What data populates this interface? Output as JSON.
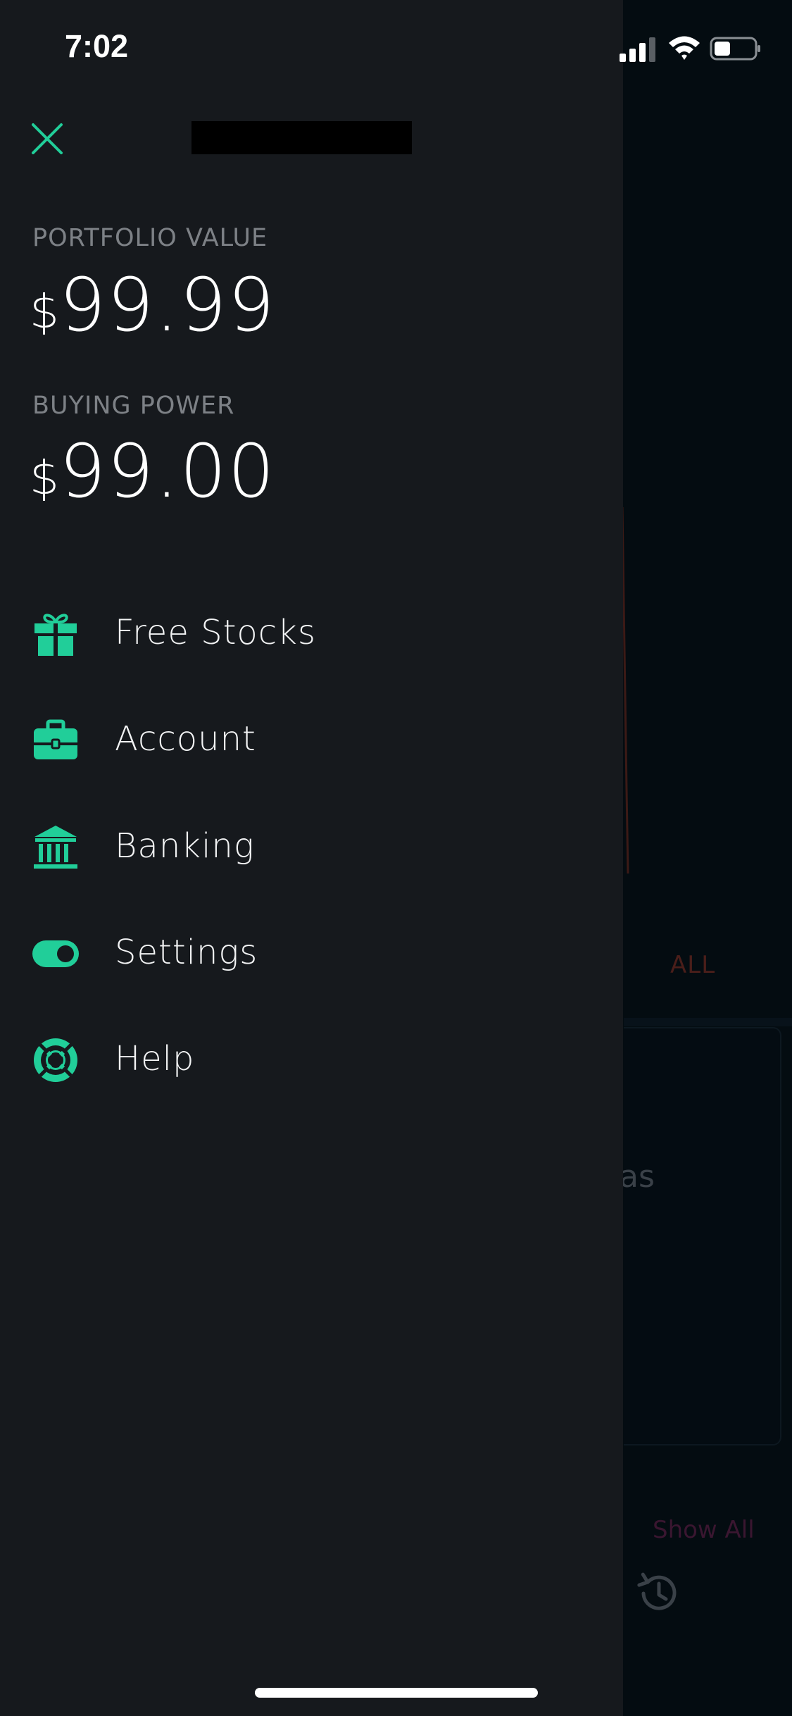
{
  "status_bar": {
    "time": "7:02",
    "signal_icon": "cellular-signal-icon",
    "wifi_icon": "wifi-icon",
    "battery_icon": "battery-icon"
  },
  "drawer": {
    "close_icon": "close-icon",
    "portfolio": {
      "label": "PORTFOLIO VALUE",
      "currency": "$",
      "value": "99.99"
    },
    "buying_power": {
      "label": "BUYING POWER",
      "currency": "$",
      "value": "99.00"
    },
    "menu": [
      {
        "label": "Free Stocks",
        "icon": "gift-icon"
      },
      {
        "label": "Account",
        "icon": "briefcase-icon"
      },
      {
        "label": "Banking",
        "icon": "bank-icon"
      },
      {
        "label": "Settings",
        "icon": "toggle-icon"
      },
      {
        "label": "Help",
        "icon": "lifebuoy-icon"
      }
    ]
  },
  "background_app": {
    "range_label": "ALL",
    "card_text_fragment": "as",
    "show_all_link": "Show All",
    "history_icon": "history-icon"
  },
  "colors": {
    "accent": "#21ce99",
    "drawer_bg": "#16191d",
    "label_gray": "#7d8186",
    "text": "#ffffff"
  }
}
